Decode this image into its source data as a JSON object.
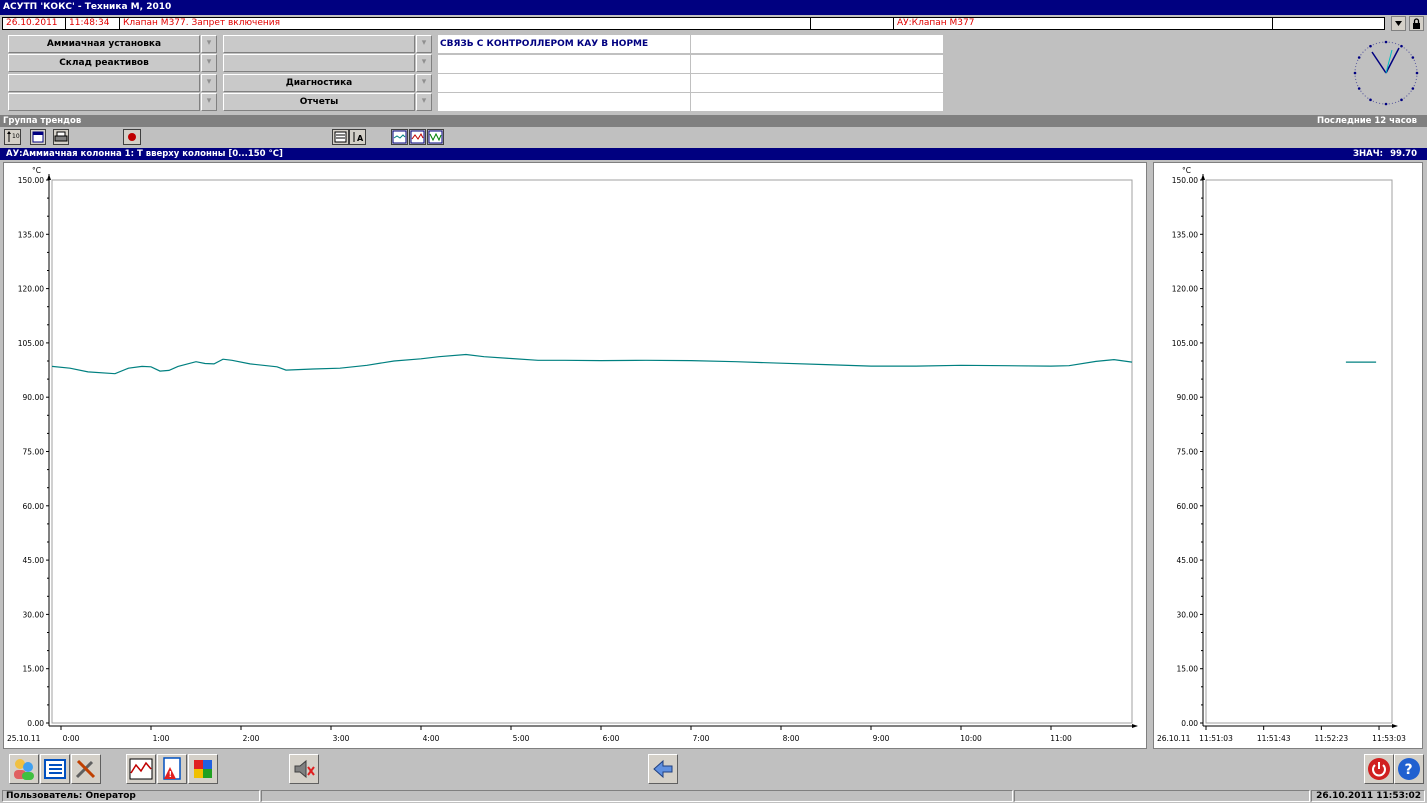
{
  "window": {
    "title": "АСУТП 'КОКС' - Техника М, 2010"
  },
  "alarm": {
    "date": "26.10.2011",
    "time": "11:48:34",
    "message": "Клапан М377. Запрет включения",
    "source": "АУ:Клапан М377"
  },
  "nav": {
    "col1": [
      "Аммиачная установка",
      "Склад реактивов",
      "",
      ""
    ],
    "col2": [
      "",
      "",
      "Диагностика",
      "Отчеты"
    ],
    "messages": [
      "СВЯЗЬ С КОНТРОЛЛЕРОМ КАУ В НОРМЕ",
      "",
      "",
      ""
    ]
  },
  "group": {
    "title": "Группа трендов",
    "period": "Последние 12 часов"
  },
  "trend": {
    "tag": "АУ:Аммиачная колонна 1: T вверху колонны [0...150 °C]",
    "value_label": "ЗНАЧ:",
    "value": "99.70"
  },
  "chart_data": [
    {
      "type": "line",
      "ylabel": "°C",
      "ylim": [
        0,
        150
      ],
      "yticks": [
        "150.00",
        "135.00",
        "120.00",
        "105.00",
        "90.00",
        "75.00",
        "60.00",
        "45.00",
        "30.00",
        "15.00",
        "0.00"
      ],
      "date_label": "25.10.11",
      "xlim": [
        -0.1,
        11.9
      ],
      "xticks": [
        {
          "label": "0:00",
          "x": 0
        },
        {
          "label": "1:00",
          "x": 1
        },
        {
          "label": "2:00",
          "x": 2
        },
        {
          "label": "3:00",
          "x": 3
        },
        {
          "label": "4:00",
          "x": 4
        },
        {
          "label": "5:00",
          "x": 5
        },
        {
          "label": "6:00",
          "x": 6
        },
        {
          "label": "7:00",
          "x": 7
        },
        {
          "label": "8:00",
          "x": 8
        },
        {
          "label": "9:00",
          "x": 9
        },
        {
          "label": "10:00",
          "x": 10
        },
        {
          "label": "11:00",
          "x": 11
        }
      ],
      "series": [
        {
          "color": "#008080",
          "x": [
            -0.1,
            0.1,
            0.3,
            0.6,
            0.75,
            0.9,
            1.0,
            1.1,
            1.2,
            1.3,
            1.5,
            1.6,
            1.7,
            1.8,
            1.9,
            2.1,
            2.4,
            2.5,
            2.8,
            3.1,
            3.4,
            3.7,
            4.0,
            4.2,
            4.5,
            4.7,
            5.0,
            5.3,
            5.6,
            6.0,
            6.5,
            7.0,
            7.5,
            8.0,
            8.5,
            9.0,
            9.5,
            10.0,
            10.5,
            11.0,
            11.2,
            11.5,
            11.7,
            11.9
          ],
          "y": [
            98.5,
            98.0,
            97.0,
            96.5,
            98.0,
            98.5,
            98.4,
            97.2,
            97.4,
            98.5,
            99.8,
            99.3,
            99.2,
            100.5,
            100.2,
            99.2,
            98.4,
            97.5,
            97.8,
            98.0,
            98.8,
            100.0,
            100.6,
            101.2,
            101.8,
            101.2,
            100.7,
            100.2,
            100.2,
            100.1,
            100.2,
            100.1,
            99.8,
            99.4,
            99.0,
            98.6,
            98.6,
            98.8,
            98.7,
            98.6,
            98.7,
            99.9,
            100.4,
            99.7
          ]
        }
      ]
    },
    {
      "type": "line",
      "ylabel": "°C",
      "ylim": [
        0,
        150
      ],
      "yticks": [
        "150.00",
        "135.00",
        "120.00",
        "105.00",
        "90.00",
        "75.00",
        "60.00",
        "45.00",
        "30.00",
        "15.00",
        "0.00"
      ],
      "date_label": "26.10.11",
      "xlim": [
        0,
        129
      ],
      "xticks": [
        {
          "label": "11:51:03",
          "x": 0
        },
        {
          "label": "11:51:43",
          "x": 40
        },
        {
          "label": "11:52:23",
          "x": 80
        },
        {
          "label": "11:53:03",
          "x": 120
        }
      ],
      "series": [
        {
          "color": "#008080",
          "x": [
            97,
            118
          ],
          "y": [
            99.7,
            99.7
          ]
        }
      ]
    }
  ],
  "status": {
    "user_label": "Пользователь:",
    "user": "Оператор",
    "datetime": "26.10.2011 11:53:02"
  }
}
